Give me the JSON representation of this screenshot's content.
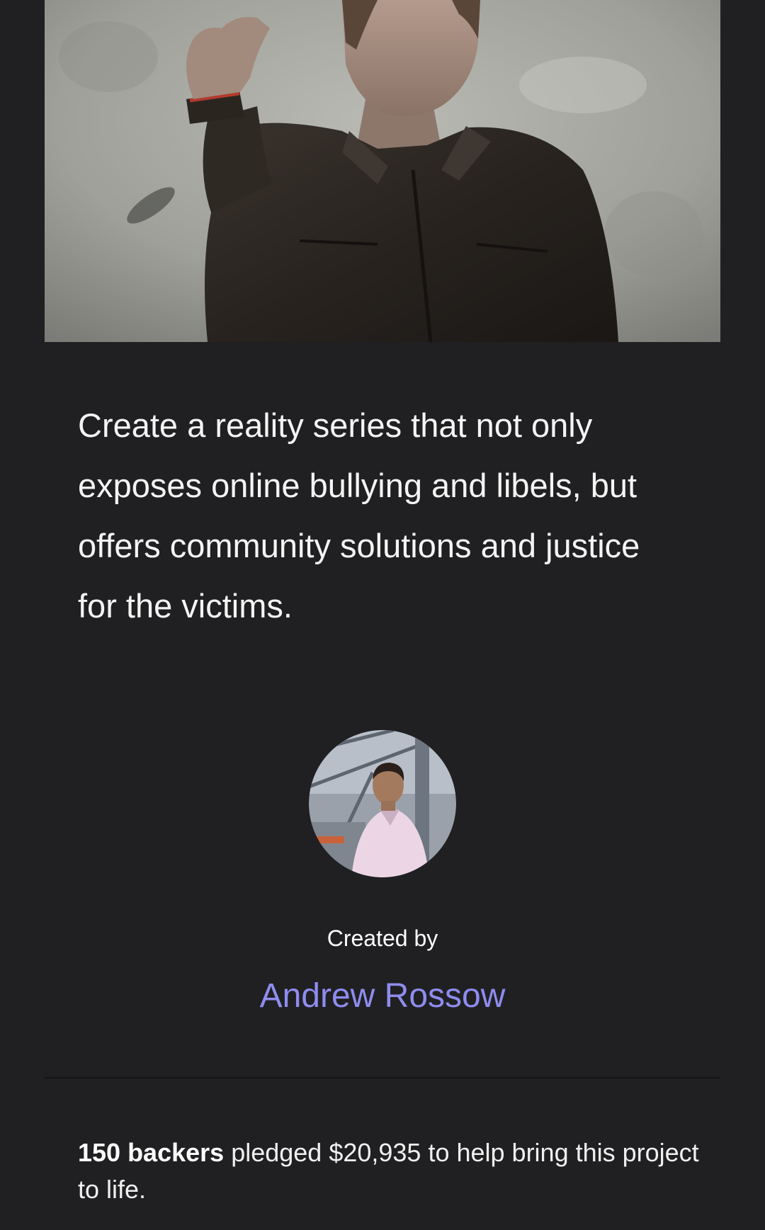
{
  "project": {
    "hero_image_alt": "Man in a dark leather jacket raising his hand",
    "blurb": "Create a reality series that not only exposes online bullying and libels, but offers community solutions and justice for the victims."
  },
  "creator": {
    "avatar_alt": "Creator avatar",
    "created_by_label": "Created by",
    "name": "Andrew Rossow"
  },
  "funding": {
    "backers_count": "150 backers",
    "pledged_text": " pledged $20,935 to help bring this project to life."
  },
  "colors": {
    "background": "#202022",
    "link": "#8f8cf0"
  }
}
